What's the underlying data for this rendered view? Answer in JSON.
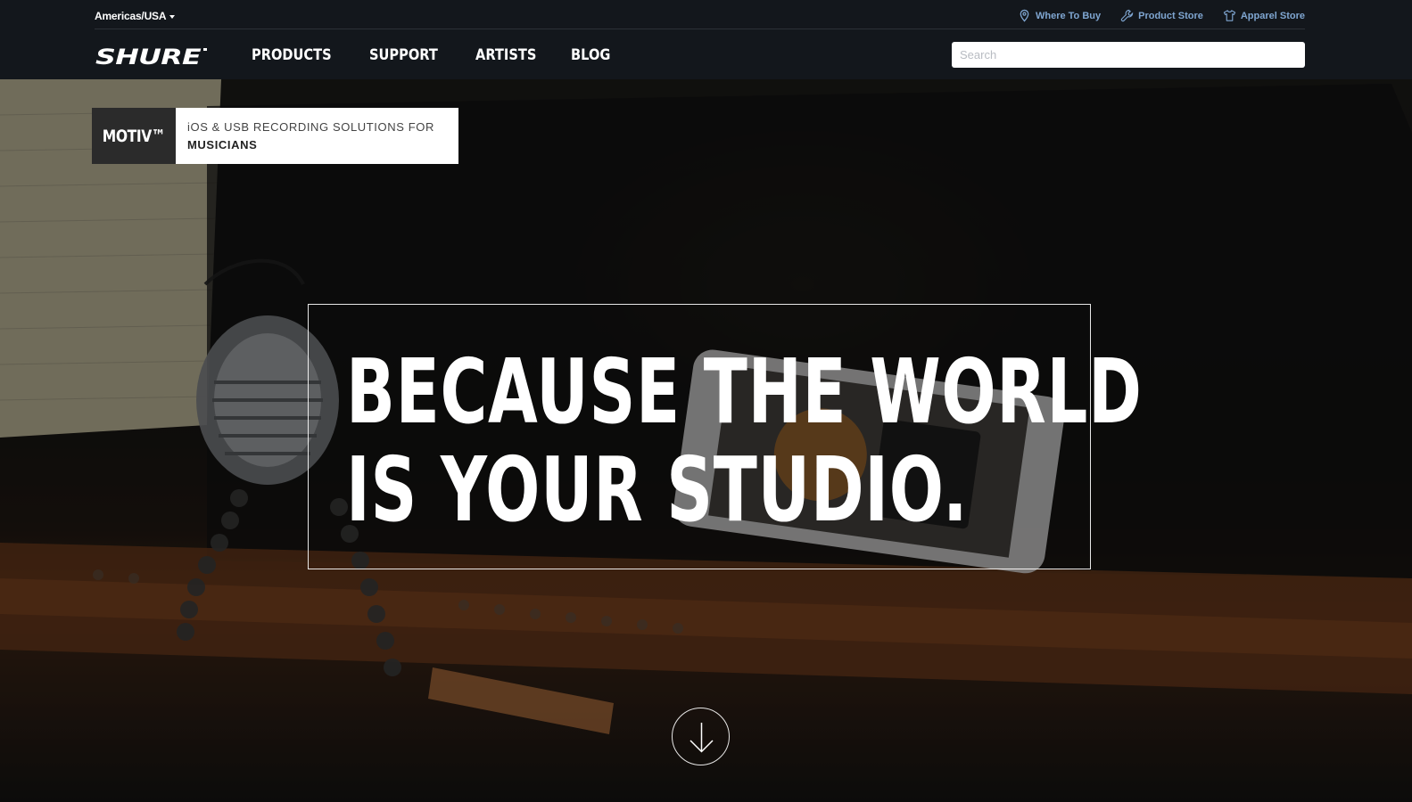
{
  "header": {
    "region": "Americas/USA",
    "utility_links": [
      {
        "label": "Where To Buy",
        "icon": "location-pin-icon"
      },
      {
        "label": "Product Store",
        "icon": "wrench-icon"
      },
      {
        "label": "Apparel Store",
        "icon": "tshirt-icon"
      }
    ],
    "logo_text": "SHURE",
    "nav": [
      "PRODUCTS",
      "SUPPORT",
      "ARTISTS",
      "BLOG"
    ],
    "search_placeholder": "Search"
  },
  "hero": {
    "tag": {
      "brand": "MOTIV™",
      "line1": "iOS & USB RECORDING SOLUTIONS FOR",
      "line2": "MUSICIANS"
    },
    "headline_line1": "BECAUSE THE WORLD",
    "headline_line2": "IS YOUR STUDIO.",
    "scroll_icon": "arrow-down-circle-icon"
  },
  "colors": {
    "header_bg": "#13171c",
    "utility_link": "#7fa6d1",
    "tag_dark": "#2b2b2b"
  }
}
